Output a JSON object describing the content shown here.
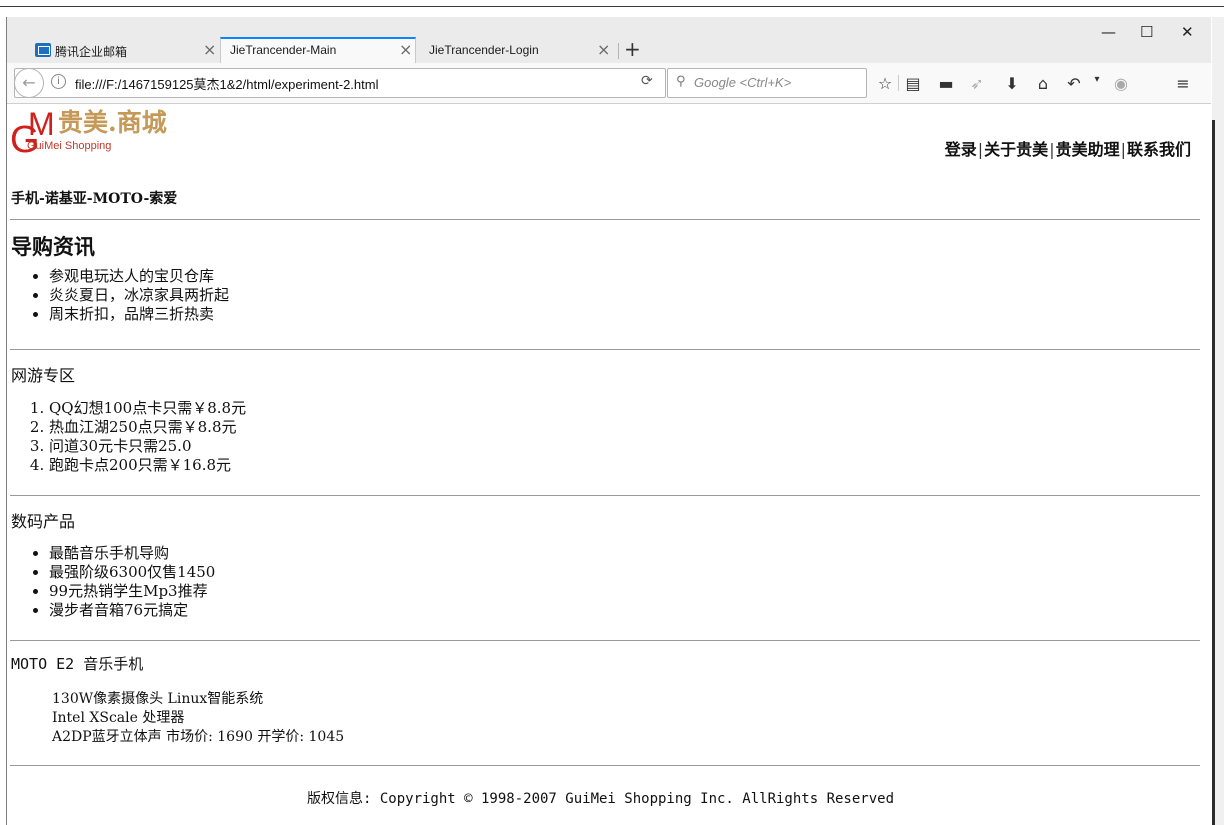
{
  "browser": {
    "tabs": [
      {
        "title": "腾讯企业邮箱"
      },
      {
        "title": "JieTrancender-Main"
      },
      {
        "title": "JieTrancender-Login"
      }
    ],
    "url": "file:///F:/1467159125莫杰1&2/html/experiment-2.html",
    "search_placeholder": "Google <Ctrl+K>"
  },
  "logo": {
    "cn": "贵美.商城",
    "en": "GuiMei Shopping"
  },
  "top_nav": [
    "登录",
    "关于贵美",
    "贵美助理",
    "联系我们"
  ],
  "categories": "手机-诺基亚-MOTO-索爱",
  "guide": {
    "title": "导购资讯",
    "items": [
      "参观电玩达人的宝贝仓库",
      "炎炎夏日，冰凉家具两折起",
      "周末折扣，品牌三折热卖"
    ]
  },
  "games": {
    "title": "网游专区",
    "items": [
      "QQ幻想100点卡只需￥8.8元",
      "热血江湖250点只需￥8.8元",
      "问道30元卡只需25.0",
      "跑跑卡点200只需￥16.8元"
    ]
  },
  "digital": {
    "title": "数码产品",
    "items": [
      "最酷音乐手机导购",
      "最强阶级6300仅售1450",
      "99元热销学生Mp3推荐",
      "漫步者音箱76元搞定"
    ]
  },
  "product": {
    "title": "MOTO E2 音乐手机",
    "lines": [
      "130W像素摄像头 Linux智能系统",
      "Intel XScale 处理器",
      "A2DP蓝牙立体声 市场价: 1690 开学价: 1045"
    ]
  },
  "footer": "版权信息: Copyright © 1998-2007 GuiMei Shopping Inc. AllRights Reserved"
}
